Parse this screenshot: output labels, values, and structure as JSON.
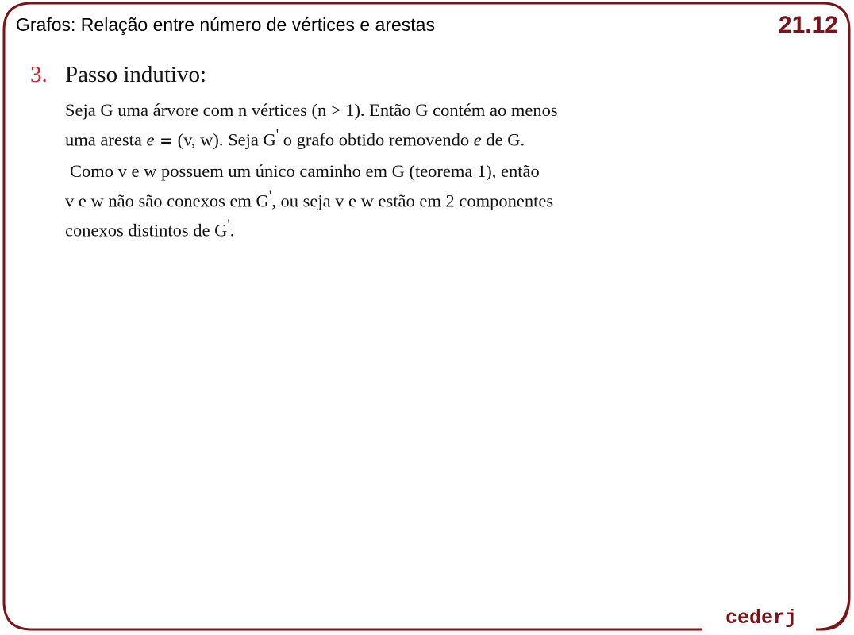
{
  "header": {
    "title": "Grafos: Relação entre número de vértices e arestas",
    "slide_number": "21.12"
  },
  "section": {
    "number": "3.",
    "heading": "Passo indutivo:"
  },
  "paragraph1": {
    "line1": "Seja G uma árvore com n vértices (n > 1).  Então G contém ao menos",
    "line2_a": "uma aresta ",
    "line2_e": "e",
    "line2_eq": " = ",
    "line2_b": "(v, w).  Seja G",
    "line2_c": " o grafo obtido removendo ",
    "line2_e2": "e",
    "line2_d": " de G."
  },
  "paragraph2": {
    "line1": "Como v e w possuem um único caminho em G (teorema 1), então",
    "line2": "v e w não são conexos em G",
    "line2_rest": ", ou seja v e w estão em 2 componentes",
    "line3": "conexos distintos de G",
    "line3_rest": "."
  },
  "prime": "'",
  "footer": {
    "logo": "cederj"
  },
  "colors": {
    "frame": "#7a1418",
    "accent": "#c0262d"
  }
}
